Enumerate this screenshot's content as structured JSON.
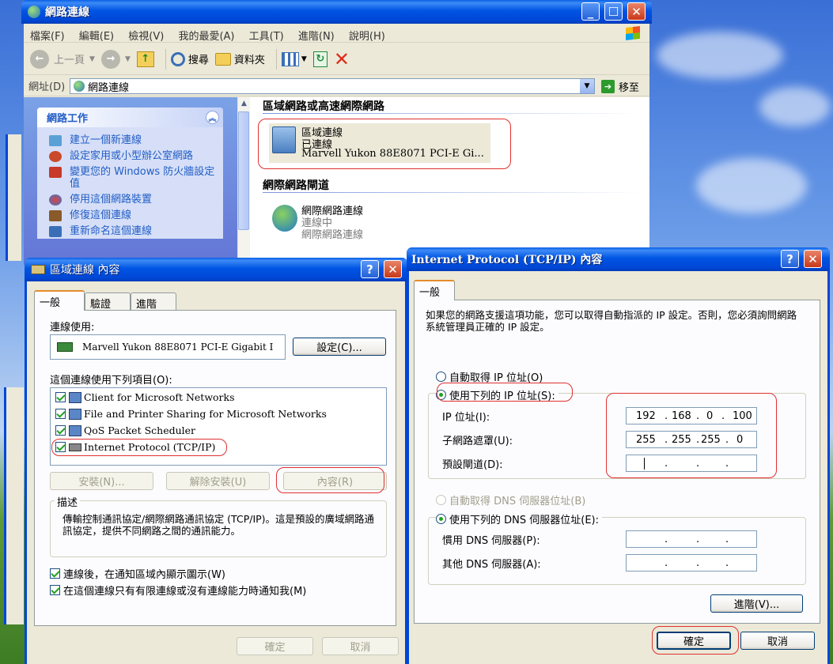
{
  "explorer": {
    "title": "網路連線",
    "menu": [
      "檔案(F)",
      "編輯(E)",
      "檢視(V)",
      "我的最愛(A)",
      "工具(T)",
      "進階(N)",
      "說明(H)"
    ],
    "toolbar": {
      "back": "上一頁",
      "search": "搜尋",
      "folders": "資料夾"
    },
    "address_label": "網址(D)",
    "address_value": "網路連線",
    "go_label": "移至",
    "sidebar": {
      "header": "網路工作",
      "items": [
        "建立一個新連線",
        "設定家用或小型辦公室網路",
        "變更您的 Windows 防火牆設定值",
        "停用這個網路裝置",
        "修復這個連線",
        "重新命名這個連線"
      ]
    },
    "sections": {
      "lan_header": "區域網路或高速網際網路",
      "lan_item": {
        "name": "區域連線",
        "status": "已連線",
        "device": "Marvell Yukon 88E8071 PCI-E Gi..."
      },
      "inet_header": "網際網路閘道",
      "inet_item": {
        "name": "網際網路連線",
        "status": "連線中",
        "desc": "網際網路連線"
      }
    }
  },
  "lan_props": {
    "title": "區域連線 內容",
    "tabs": [
      "一般",
      "驗證",
      "進階"
    ],
    "connect_using_label": "連線使用:",
    "adapter": "Marvell Yukon 88E8071 PCI-E Gigabit I",
    "configure_btn": "設定(C)...",
    "items_label": "這個連線使用下列項目(O):",
    "items": [
      {
        "label": "Client for Microsoft Networks",
        "checked": true
      },
      {
        "label": "File and Printer Sharing for Microsoft Networks",
        "checked": true
      },
      {
        "label": "QoS Packet Scheduler",
        "checked": true
      },
      {
        "label": "Internet Protocol (TCP/IP)",
        "checked": true
      }
    ],
    "install_btn": "安裝(N)...",
    "uninstall_btn": "解除安裝(U)",
    "properties_btn": "內容(R)",
    "desc_label": "描述",
    "desc_text": "傳輸控制通訊協定/網際網路通訊協定 (TCP/IP)。這是預設的廣域網路通訊協定，提供不同網路之間的通訊能力。",
    "notify_icon": "連線後，在通知區域內顯示圖示(W)",
    "notify_limited": "在這個連線只有有限連線或沒有連線能力時通知我(M)",
    "ok_btn": "確定",
    "cancel_btn": "取消"
  },
  "tcpip": {
    "title": "Internet Protocol (TCP/IP) 內容",
    "tab": "一般",
    "intro": "如果您的網路支援這項功能，您可以取得自動指派的 IP 設定。否則，您必須詢問網路系統管理員正確的 IP 設定。",
    "auto_ip": "自動取得 IP 位址(O)",
    "manual_ip": "使用下列的 IP 位址(S):",
    "ip_label": "IP 位址(I):",
    "mask_label": "子網路遮罩(U):",
    "gateway_label": "預設閘道(D):",
    "ip": [
      "192",
      "168",
      "0",
      "100"
    ],
    "mask": [
      "255",
      "255",
      "255",
      "0"
    ],
    "auto_dns": "自動取得 DNS 伺服器位址(B)",
    "manual_dns": "使用下列的 DNS 伺服器位址(E):",
    "pref_dns": "慣用 DNS 伺服器(P):",
    "alt_dns": "其他 DNS 伺服器(A):",
    "advanced_btn": "進階(V)...",
    "ok_btn": "確定",
    "cancel_btn": "取消"
  }
}
